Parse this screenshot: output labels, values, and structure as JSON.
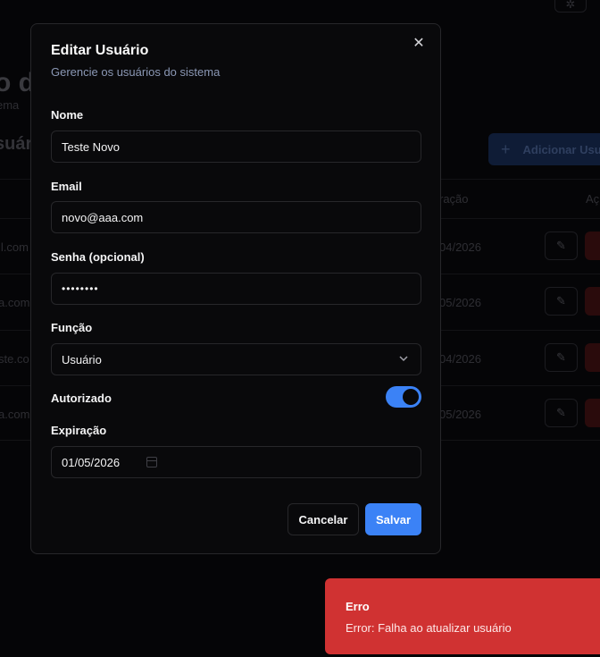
{
  "background": {
    "title": "o d",
    "subtitle": "ema",
    "section_title": "suári",
    "add_button": {
      "icon": "plus-icon",
      "label": "Adicionar Usu"
    },
    "table": {
      "headers": [
        "ração",
        "Aç"
      ],
      "rows": [
        {
          "email": "il.com",
          "expiration": "04/2026"
        },
        {
          "email": "a.com",
          "expiration": "05/2026"
        },
        {
          "email": "ste.co",
          "expiration": "04/2026"
        },
        {
          "email": "a.com",
          "expiration": "05/2026"
        }
      ]
    }
  },
  "dialog": {
    "title": "Editar Usuário",
    "description": "Gerencie os usuários do sistema",
    "fields": {
      "name": {
        "label": "Nome",
        "value": "Teste Novo"
      },
      "email": {
        "label": "Email",
        "value": "novo@aaa.com"
      },
      "password": {
        "label": "Senha (opcional)",
        "value": "••••••••"
      },
      "role": {
        "label": "Função",
        "value": "Usuário"
      },
      "authorized": {
        "label": "Autorizado",
        "checked": true
      },
      "expiration": {
        "label": "Expiração",
        "value": "01/05/2026"
      }
    },
    "buttons": {
      "cancel": "Cancelar",
      "save": "Salvar"
    }
  },
  "toast": {
    "title": "Erro",
    "message": "Error: Falha ao atualizar usuário",
    "color": "#d03232"
  },
  "colors": {
    "accent": "#3b82f6",
    "destructive": "#d03232",
    "background": "#09090b"
  }
}
